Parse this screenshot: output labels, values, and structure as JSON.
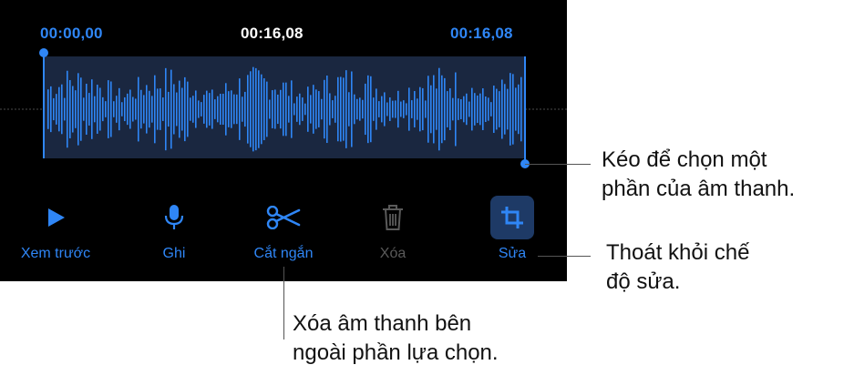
{
  "times": {
    "start": "00:00,00",
    "current": "00:16,08",
    "end": "00:16,08"
  },
  "toolbar": [
    {
      "name": "preview-button",
      "icon": "play-icon",
      "label": "Xem trước",
      "enabled": true
    },
    {
      "name": "record-button",
      "icon": "microphone-icon",
      "label": "Ghi",
      "enabled": true
    },
    {
      "name": "trim-button",
      "icon": "scissors-icon",
      "label": "Cắt ngắn",
      "enabled": true
    },
    {
      "name": "delete-button",
      "icon": "trash-icon",
      "label": "Xóa",
      "enabled": false
    },
    {
      "name": "edit-button",
      "icon": "crop-icon",
      "label": "Sửa",
      "enabled": true,
      "active": true
    }
  ],
  "callouts": {
    "drag": [
      "Kéo để chọn một",
      "phần của âm thanh."
    ],
    "exit": [
      "Thoát khỏi chế",
      "độ sửa."
    ],
    "trim": [
      "Xóa âm thanh bên",
      "ngoài phần lựa chọn."
    ]
  },
  "colors": {
    "accent": "#2f86f6",
    "editor_background": "#000000",
    "selection": "#1a2740",
    "disabled": "#5a5a5a"
  }
}
